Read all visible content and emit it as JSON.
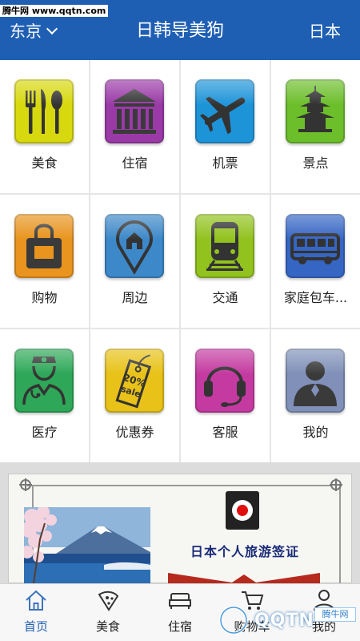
{
  "watermark_top": "腾牛网 www.qqtn.com",
  "header": {
    "city": "东京",
    "title": "日韩导美狗",
    "country": "日本"
  },
  "grid": [
    {
      "label": "美食",
      "icon": "fork-knife-spoon-icon",
      "color": "#d8d80e"
    },
    {
      "label": "住宿",
      "icon": "building-columns-icon",
      "color": "#9a3aa6"
    },
    {
      "label": "机票",
      "icon": "airplane-icon",
      "color": "#1e94d8"
    },
    {
      "label": "景点",
      "icon": "pagoda-icon",
      "color": "#6cbe2a"
    },
    {
      "label": "购物",
      "icon": "shopping-bag-icon",
      "color": "#e8941e"
    },
    {
      "label": "周边",
      "icon": "map-pin-home-icon",
      "color": "#3d88c8"
    },
    {
      "label": "交通",
      "icon": "train-icon",
      "color": "#92c21e"
    },
    {
      "label": "家庭包车...",
      "icon": "bus-icon",
      "color": "#3666c4"
    },
    {
      "label": "医疗",
      "icon": "nurse-doctor-icon",
      "color": "#2ea858"
    },
    {
      "label": "优惠券",
      "icon": "sale-tag-icon",
      "color": "#e8c218"
    },
    {
      "label": "客服",
      "icon": "headset-icon",
      "color": "#c43aa0"
    },
    {
      "label": "我的",
      "icon": "user-silhouette-icon",
      "color": "#8090b8"
    }
  ],
  "banner": {
    "title": "日本个人旅游签证"
  },
  "nav": [
    {
      "label": "首页",
      "icon": "home-icon",
      "active": true
    },
    {
      "label": "美食",
      "icon": "pizza-slice-icon",
      "active": false
    },
    {
      "label": "住宿",
      "icon": "bed-icon",
      "active": false
    },
    {
      "label": "购物车",
      "icon": "cart-icon",
      "active": false
    },
    {
      "label": "我的",
      "icon": "profile-icon",
      "active": false
    }
  ],
  "watermark_bottom": {
    "logo": "QQTN",
    "badge": "腾牛网"
  }
}
